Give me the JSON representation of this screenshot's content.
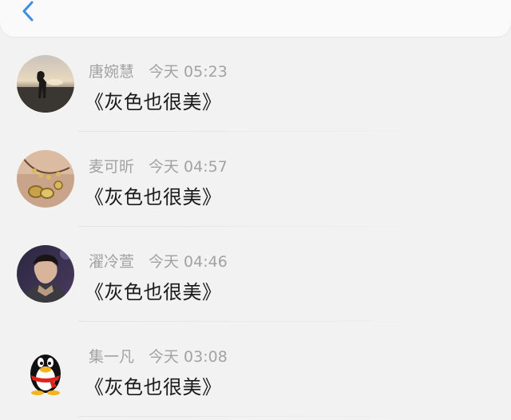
{
  "header": {
    "back_icon": "chevron-left-icon",
    "accent_color": "#3a8ee6"
  },
  "comments": [
    {
      "name": "唐婉慧",
      "time": "今天 05:23",
      "text": "《灰色也很美》",
      "avatar": "sunset-silhouette-avatar"
    },
    {
      "name": "麦可昕",
      "time": "今天 04:57",
      "text": "《灰色也很美》",
      "avatar": "jewelry-avatar"
    },
    {
      "name": "濯冷萱",
      "time": "今天 04:46",
      "text": "《灰色也很美》",
      "avatar": "portrait-avatar"
    },
    {
      "name": "集一凡",
      "time": "今天 03:08",
      "text": "《灰色也很美》",
      "avatar": "qq-penguin-avatar"
    }
  ]
}
